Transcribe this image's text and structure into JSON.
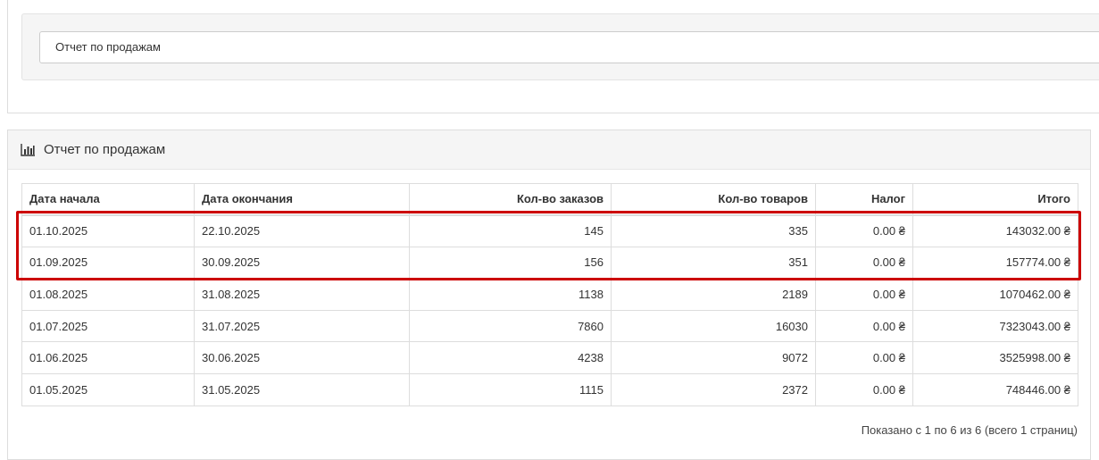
{
  "filter": {
    "report_selected": "Отчет по продажам"
  },
  "report": {
    "title": "Отчет по продажам",
    "icon": "bar-chart-icon",
    "columns": [
      "Дата начала",
      "Дата окончания",
      "Кол-во заказов",
      "Кол-во товаров",
      "Налог",
      "Итого"
    ],
    "rows": [
      [
        "01.10.2025",
        "22.10.2025",
        "145",
        "335",
        "0.00 ₴",
        "143032.00 ₴"
      ],
      [
        "01.09.2025",
        "30.09.2025",
        "156",
        "351",
        "0.00 ₴",
        "157774.00 ₴"
      ],
      [
        "01.08.2025",
        "31.08.2025",
        "1138",
        "2189",
        "0.00 ₴",
        "1070462.00 ₴"
      ],
      [
        "01.07.2025",
        "31.07.2025",
        "7860",
        "16030",
        "0.00 ₴",
        "7323043.00 ₴"
      ],
      [
        "01.06.2025",
        "30.06.2025",
        "4238",
        "9072",
        "0.00 ₴",
        "3525998.00 ₴"
      ],
      [
        "01.05.2025",
        "31.05.2025",
        "1115",
        "2372",
        "0.00 ₴",
        "748446.00 ₴"
      ]
    ],
    "pagination_text": "Показано с 1 по 6 из 6 (всего 1 страниц)"
  },
  "colors": {
    "highlight": "#cc0000",
    "panel_heading_bg": "#f5f5f5",
    "border": "#dddddd"
  }
}
